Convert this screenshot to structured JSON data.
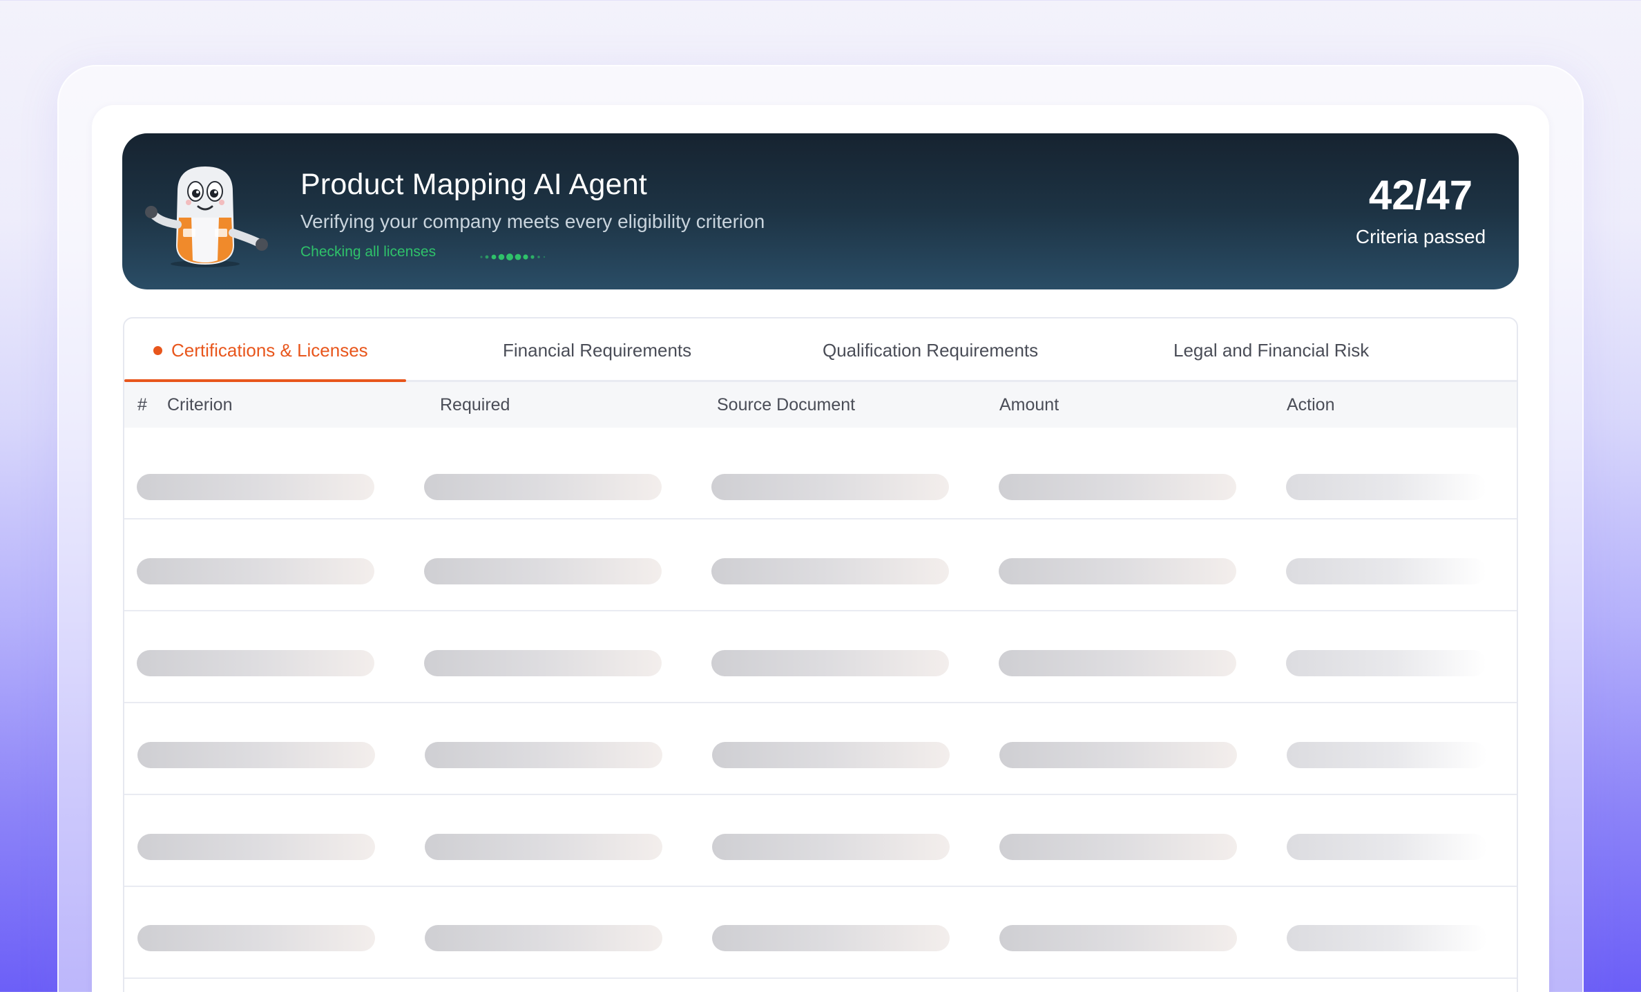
{
  "hero": {
    "title": "Product Mapping AI Agent",
    "subtitle": "Verifying your company meets every eligibility criterion",
    "status": "Checking all licenses",
    "score_value": "42/47",
    "score_label": "Criteria passed",
    "mascot_icon": "robot-mascot-icon"
  },
  "tabs": [
    {
      "label": "Certifications & Licenses",
      "active": true
    },
    {
      "label": "Financial Requirements",
      "active": false
    },
    {
      "label": "Qualification Requirements",
      "active": false
    },
    {
      "label": "Legal and Financial Risk",
      "active": false
    }
  ],
  "table": {
    "columns": [
      "#",
      "Criterion",
      "Required",
      "Source Document",
      "Amount",
      "Action"
    ],
    "loading_rows": 6
  },
  "colors": {
    "accent": "#e8561c",
    "status_green": "#2fc26a",
    "hero_dark": "#162330"
  }
}
